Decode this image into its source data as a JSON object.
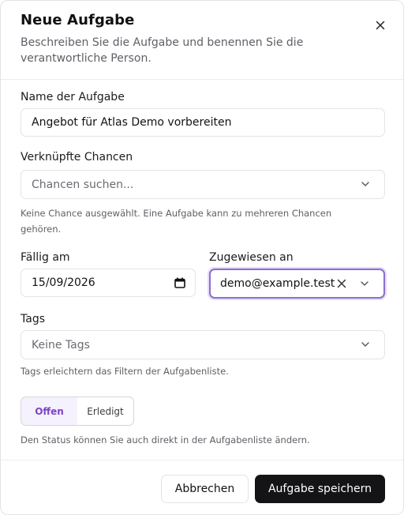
{
  "dialog": {
    "title": "Neue Aufgabe",
    "description": "Beschreiben Sie die Aufgabe und benennen Sie die verantwortliche Person."
  },
  "fields": {
    "name": {
      "label": "Name der Aufgabe",
      "value": "Angebot für Atlas Demo vorbereiten"
    },
    "chances": {
      "label": "Verknüpfte Chancen",
      "placeholder": "Chancen suchen...",
      "hint": "Keine Chance ausgewählt. Eine Aufgabe kann zu mehreren Chancen gehören."
    },
    "due": {
      "label": "Fällig am",
      "value": "15/09/2026"
    },
    "assignee": {
      "label": "Zugewiesen an",
      "value": "demo@example.test"
    },
    "tags": {
      "label": "Tags",
      "placeholder": "Keine Tags",
      "hint": "Tags erleichtern das Filtern der Aufgabenliste."
    }
  },
  "status": {
    "options": [
      "Offen",
      "Erledigt"
    ],
    "selected": "Offen",
    "hint": "Den Status können Sie auch direkt in der Aufgabenliste ändern."
  },
  "footer": {
    "cancel_label": "Abbrechen",
    "save_label": "Aufgabe speichern"
  },
  "colors": {
    "accent": "#7b45c7",
    "focus_ring": "#8b6fd0",
    "primary_button": "#141416"
  },
  "icons": {
    "close": "close-icon",
    "chevron": "chevron-down-icon",
    "calendar": "calendar-icon",
    "clear": "clear-icon"
  }
}
